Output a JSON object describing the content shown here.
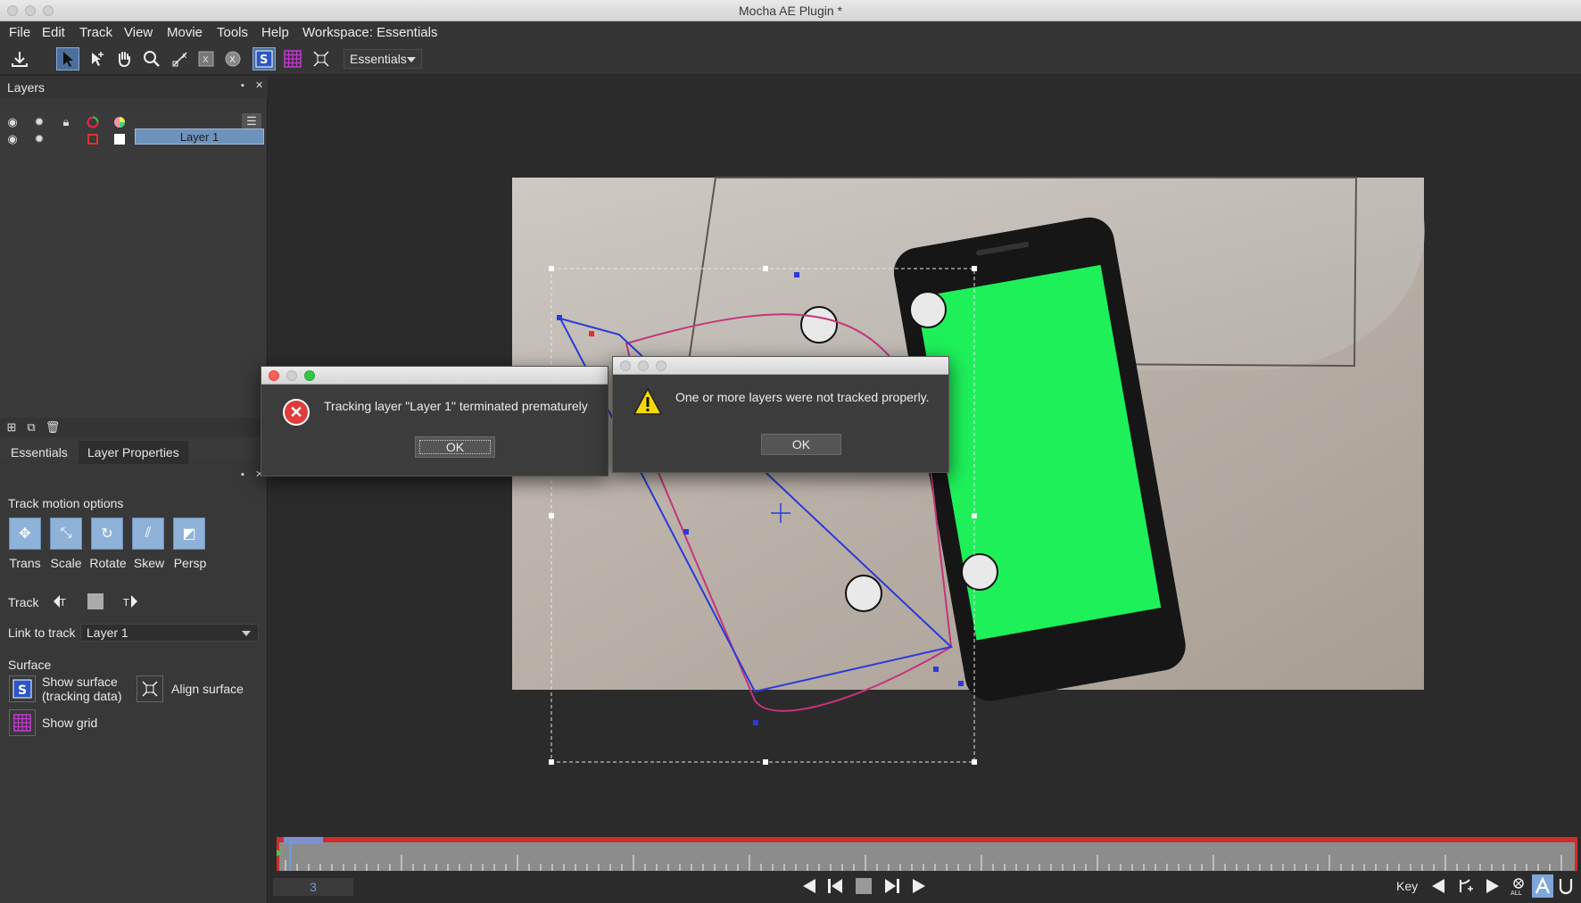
{
  "window": {
    "title": "Mocha AE Plugin *"
  },
  "menu": [
    "File",
    "Edit",
    "Track",
    "View",
    "Movie",
    "Tools",
    "Help",
    "Workspace: Essentials"
  ],
  "toolbar": {
    "workspace_select": "Essentials"
  },
  "layers_panel": {
    "title": "Layers",
    "layers": [
      {
        "name": "Layer 1"
      }
    ]
  },
  "properties": {
    "tabs": [
      "Essentials",
      "Layer Properties"
    ],
    "active_tab": "Layer Properties",
    "track_motion_label": "Track motion options",
    "motion_options": [
      "Trans",
      "Scale",
      "Rotate",
      "Skew",
      "Persp"
    ],
    "track_label": "Track",
    "link_to_track_label": "Link to track",
    "link_to_track_value": "Layer 1",
    "surface_label": "Surface",
    "show_surface_line1": "Show surface",
    "show_surface_line2": "(tracking data)",
    "align_surface": "Align surface",
    "show_grid": "Show grid"
  },
  "dialog_error": {
    "message": "Tracking layer \"Layer 1\" terminated prematurely",
    "ok": "OK"
  },
  "dialog_warning": {
    "message": "One or more layers were not tracked properly.",
    "ok": "OK"
  },
  "timeline": {
    "current_frame": "3"
  },
  "transport": {
    "key_label": "Key"
  },
  "colors": {
    "accent": "#6d93bc",
    "error": "#e23b3b",
    "warning": "#f5d90a",
    "timeline_range": "#d02b2b",
    "green_screen": "#1ef05a"
  }
}
